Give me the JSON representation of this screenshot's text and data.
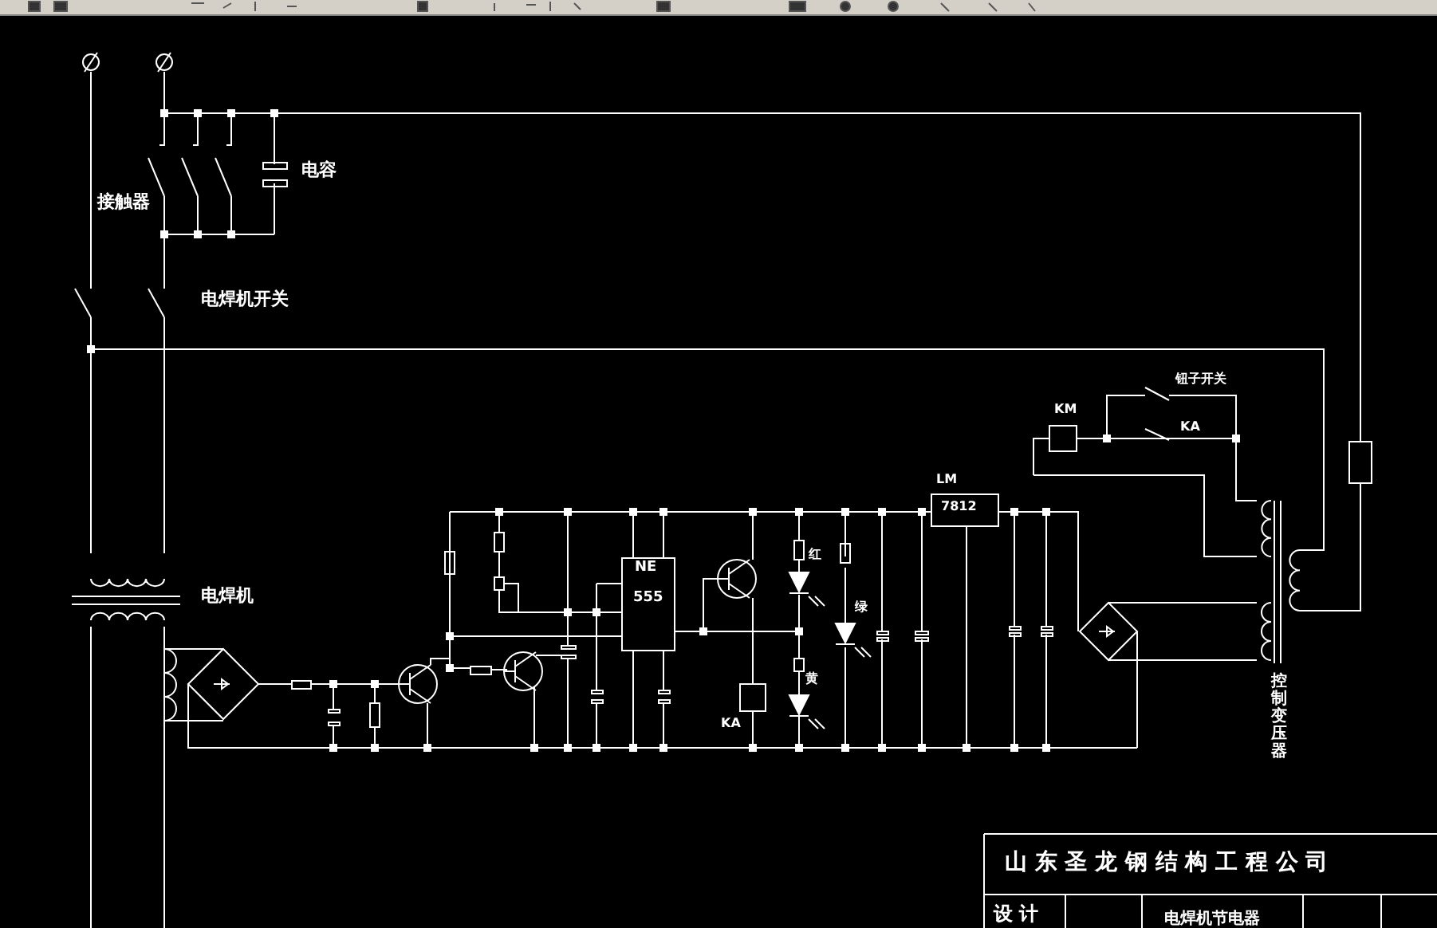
{
  "labels": [
    {
      "text": "接触器"
    },
    {
      "text": "电容"
    },
    {
      "text": "电焊机开关"
    },
    {
      "text": "电焊机"
    },
    {
      "text": "NE"
    },
    {
      "text": "555"
    },
    {
      "text": "红"
    },
    {
      "text": "绿"
    },
    {
      "text": "黄"
    },
    {
      "text": "KA"
    },
    {
      "text": "LM"
    },
    {
      "text": "7812"
    },
    {
      "text": "KM"
    },
    {
      "text": "钮子开关"
    },
    {
      "text": "KA"
    },
    {
      "text": "控制变压器"
    }
  ],
  "title_block": {
    "company": "山 东 圣 龙 钢 结 构 工 程 公 司",
    "designer_label": "设 计",
    "drawing_title": "电焊机节电器"
  }
}
